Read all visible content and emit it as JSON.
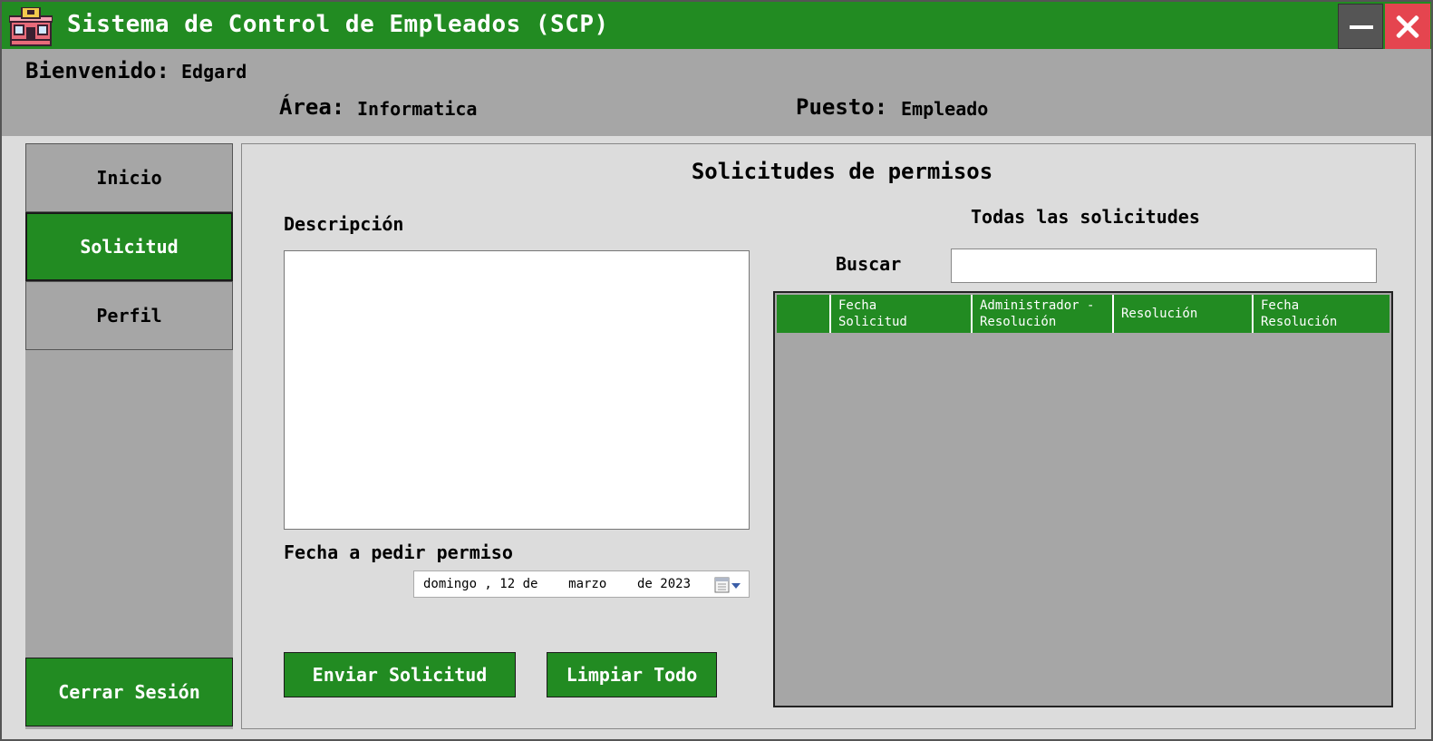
{
  "window": {
    "title": "Sistema de Control de Empleados (SCP)",
    "accent_color": "#228b22",
    "close_color": "#e5454f"
  },
  "header": {
    "welcome_label": "Bienvenido:",
    "welcome_value": "Edgard",
    "area_label": "Área:",
    "area_value": "Informatica",
    "position_label": "Puesto:",
    "position_value": "Empleado"
  },
  "sidebar": {
    "items": [
      {
        "label": "Inicio",
        "active": false
      },
      {
        "label": "Solicitud",
        "active": true
      },
      {
        "label": "Perfil",
        "active": false
      }
    ],
    "logout_label": "Cerrar Sesión"
  },
  "main": {
    "title": "Solicitudes de permisos",
    "description_label": "Descripción",
    "description_value": "",
    "date_label": "Fecha a pedir permiso",
    "date_value": "domingo , 12 de    marzo    de 2023",
    "send_button": "Enviar Solicitud",
    "clear_button": "Limpiar Todo",
    "list_title": "Todas las solicitudes",
    "search_label": "Buscar",
    "search_value": "",
    "columns": [
      "",
      "Fecha\nSolicitud",
      "Administrador -\nResolución",
      "Resolución",
      "Fecha\nResolución"
    ],
    "rows": []
  }
}
